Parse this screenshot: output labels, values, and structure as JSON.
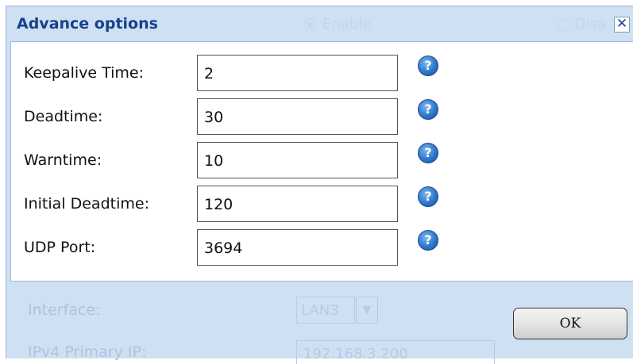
{
  "dialog": {
    "title": "Advance options",
    "close_label": "✕",
    "ok_label": "OK"
  },
  "background": {
    "radio_enable": "Enable",
    "radio_disable": "Disa",
    "interface_label": "Interface:",
    "interface_value": "LAN3",
    "ipv4_label": "IPv4 Primary IP:",
    "ipv4_value": "192.168.3.200"
  },
  "fields": [
    {
      "label": "Keepalive Time:",
      "value": "2",
      "help": "?"
    },
    {
      "label": "Deadtime:",
      "value": "30",
      "help": "?"
    },
    {
      "label": "Warntime:",
      "value": "10",
      "help": "?"
    },
    {
      "label": "Initial Deadtime:",
      "value": "120",
      "help": "?"
    },
    {
      "label": "UDP Port:",
      "value": "3694",
      "help": "?"
    }
  ],
  "icons": {
    "help": "help-question-icon",
    "close": "close-icon",
    "dropdown": "chevron-down-icon"
  },
  "colors": {
    "title_text": "#15428b",
    "dialog_bg": "#cfe0f3",
    "panel_bg": "#ffffff",
    "help_icon": "#2f76c9"
  }
}
